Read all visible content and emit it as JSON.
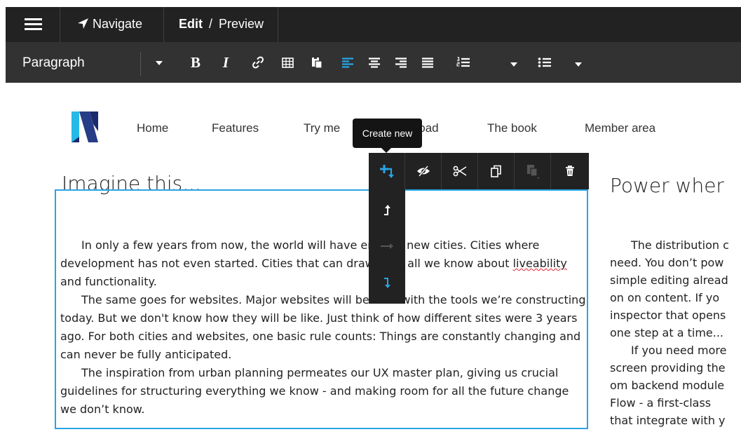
{
  "topbar": {
    "menu_icon": "hamburger-menu-icon",
    "navigate_label": "Navigate",
    "navigate_icon": "location-arrow-icon",
    "edit_label": "Edit",
    "separator": "/",
    "preview_label": "Preview"
  },
  "toolbar": {
    "paragraph_style": "Paragraph",
    "bold_label": "B",
    "italic_label": "I",
    "buttons": [
      "link-icon",
      "table-icon",
      "paste-icon",
      "align-left-icon",
      "align-center-icon",
      "align-right-icon",
      "align-justify-icon",
      "ordered-list-icon",
      "unordered-list-icon"
    ],
    "active_color": "#29a4e4"
  },
  "site_nav": {
    "logo": "N",
    "items": [
      "Home",
      "Features",
      "Try me",
      "Download",
      "The book",
      "Member area"
    ]
  },
  "node_toolbar": {
    "tooltip": "Create new",
    "buttons": [
      "add-node-icon",
      "hide-icon",
      "cut-icon",
      "copy-icon",
      "paste-icon",
      "delete-icon"
    ],
    "insert_options": [
      "insert-above-icon",
      "insert-into-icon",
      "insert-below-icon"
    ]
  },
  "content": {
    "heading": "Imagine this...",
    "p1_before": "In only a few years from now, the world will ",
    "p1_hidden": "have",
    "p1_after": " entirely new cities. Cities where development has not even started. Cities ",
    "p1_hidden2": "that",
    "p1_after2": " can draw from all we know about ",
    "p1_misspelled": "liveability",
    "p1_end": " and functionality.",
    "p2_before": "The same goes for websites. Major websites ",
    "p2_hidden": "will",
    "p2_after": " be built with the tools we’re constructing today. But we don't know how they will be like. Just think of how different sites were 3 years ago. For both cities and websites, one basic rule counts: Things are constantly changing and can never be fully anticipated.",
    "p3": "The inspiration from urban planning permeates our UX master plan, giving us crucial guidelines for structuring everything we know  - and making room for all the future change we don’t know."
  },
  "right_column": {
    "heading": "Power wher",
    "lines_p1": [
      "The distribution c",
      "need. You don’t pow",
      "simple editing alread",
      "on on content. If yo",
      "inspector that opens",
      "one step at a time..."
    ],
    "lines_p2": [
      "If you need more",
      "screen providing the",
      "om backend module",
      "Flow - a first-class",
      "that integrate with y"
    ]
  }
}
